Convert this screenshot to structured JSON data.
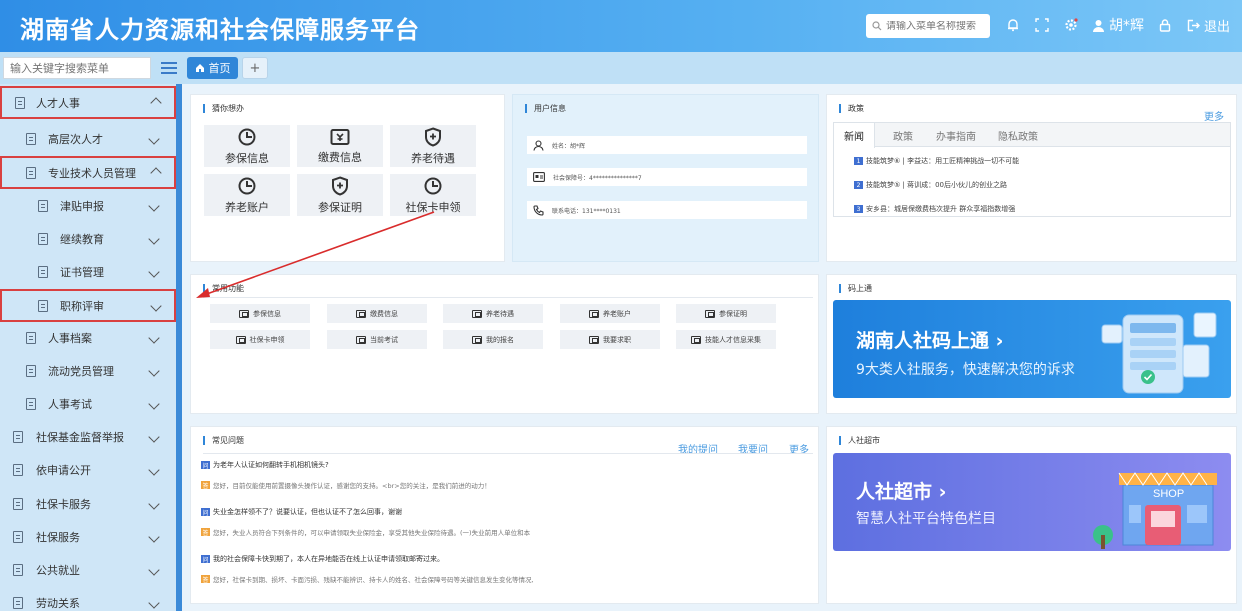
{
  "header": {
    "title": "湖南省人力资源和社会保障服务平台",
    "search_placeholder": "请输入菜单名称搜索",
    "user_name": "胡*辉",
    "logout_label": "退出"
  },
  "subbar": {
    "menu_search_placeholder": "输入关键字搜索菜单",
    "home_tab": "首页",
    "add_tab": "+"
  },
  "sidebar": {
    "items": [
      {
        "label": "人才人事"
      },
      {
        "label": "高层次人才"
      },
      {
        "label": "专业技术人员管理"
      },
      {
        "label": "津贴申报"
      },
      {
        "label": "继续教育"
      },
      {
        "label": "证书管理"
      },
      {
        "label": "职称评审"
      },
      {
        "label": "人事档案"
      },
      {
        "label": "流动党员管理"
      },
      {
        "label": "人事考试"
      },
      {
        "label": "社保基金监督举报"
      },
      {
        "label": "依申请公开"
      },
      {
        "label": "社保卡服务"
      },
      {
        "label": "社保服务"
      },
      {
        "label": "公共就业"
      },
      {
        "label": "劳动关系"
      }
    ]
  },
  "guess": {
    "title": "猜你想办",
    "tiles": [
      {
        "label": "参保信息"
      },
      {
        "label": "缴费信息"
      },
      {
        "label": "养老待遇"
      },
      {
        "label": "养老账户"
      },
      {
        "label": "参保证明"
      },
      {
        "label": "社保卡申领"
      }
    ]
  },
  "user_info": {
    "title": "用户信息",
    "name_row": "姓名：胡*辉",
    "card_row": "社会保障号：4***************7",
    "phone_row": "联系电话：131****0131"
  },
  "policy": {
    "title": "政策",
    "more": "更多",
    "tabs": [
      "新闻",
      "政策",
      "办事指南",
      "隐私政策"
    ],
    "news": [
      {
        "badge": "1",
        "text": "技能筑梦⑥ | 李益达：用工匠精神挑战一切不可能"
      },
      {
        "badge": "2",
        "text": "技能筑梦⑤ | 蒋训成：00后小伙儿的创业之路"
      },
      {
        "badge": "3",
        "text": "安乡县：城居保缴费档次提升 群众享福指数增强"
      }
    ]
  },
  "common": {
    "title": "常用功能",
    "items": [
      {
        "label": "参保信息"
      },
      {
        "label": "缴费信息"
      },
      {
        "label": "养老待遇"
      },
      {
        "label": "养老账户"
      },
      {
        "label": "参保证明"
      },
      {
        "label": "社保卡申领"
      },
      {
        "label": "当前考试"
      },
      {
        "label": "我的报名"
      },
      {
        "label": "我要求职"
      },
      {
        "label": "技能人才信息采集"
      }
    ]
  },
  "code": {
    "title": "码上通",
    "banner_title": "湖南人社码上通",
    "banner_sub": "9大类人社服务，快速解决您的诉求"
  },
  "faq": {
    "title": "常见问题",
    "links": [
      "我的提问",
      "我要问",
      "更多"
    ],
    "items": [
      {
        "q": "为老年人认证如何翻转手机相机镜头?",
        "a": "您好，目前仅能使用前置摄像头操作认证，感谢您的支持。<br>您的关注，是我们前进的动力！"
      },
      {
        "q": "失业金怎样领不了？说要认证，但也认证不了怎么回事，谢谢",
        "a": "您好，失业人员符合下列条件的，可以申请领取失业保险金，享受其他失业保险待遇。(一)失业前用人单位和本"
      },
      {
        "q": "我的社会保障卡快到期了，本人在异地能否在线上认证申请领取邮寄过来。",
        "a": "您好，社保卡到期、损坏、卡面污损、残缺不能辨识、持卡人的姓名、社会保障号码等关键信息发生变化等情况,"
      }
    ]
  },
  "market": {
    "title": "人社超市",
    "banner_title": "人社超市",
    "banner_sub": "智慧人社平台特色栏目",
    "shop_sign": "SHOP"
  },
  "colors": {
    "accent": "#2f86d8",
    "highlight_border": "#d94040",
    "arrow": "#d92c2c"
  }
}
